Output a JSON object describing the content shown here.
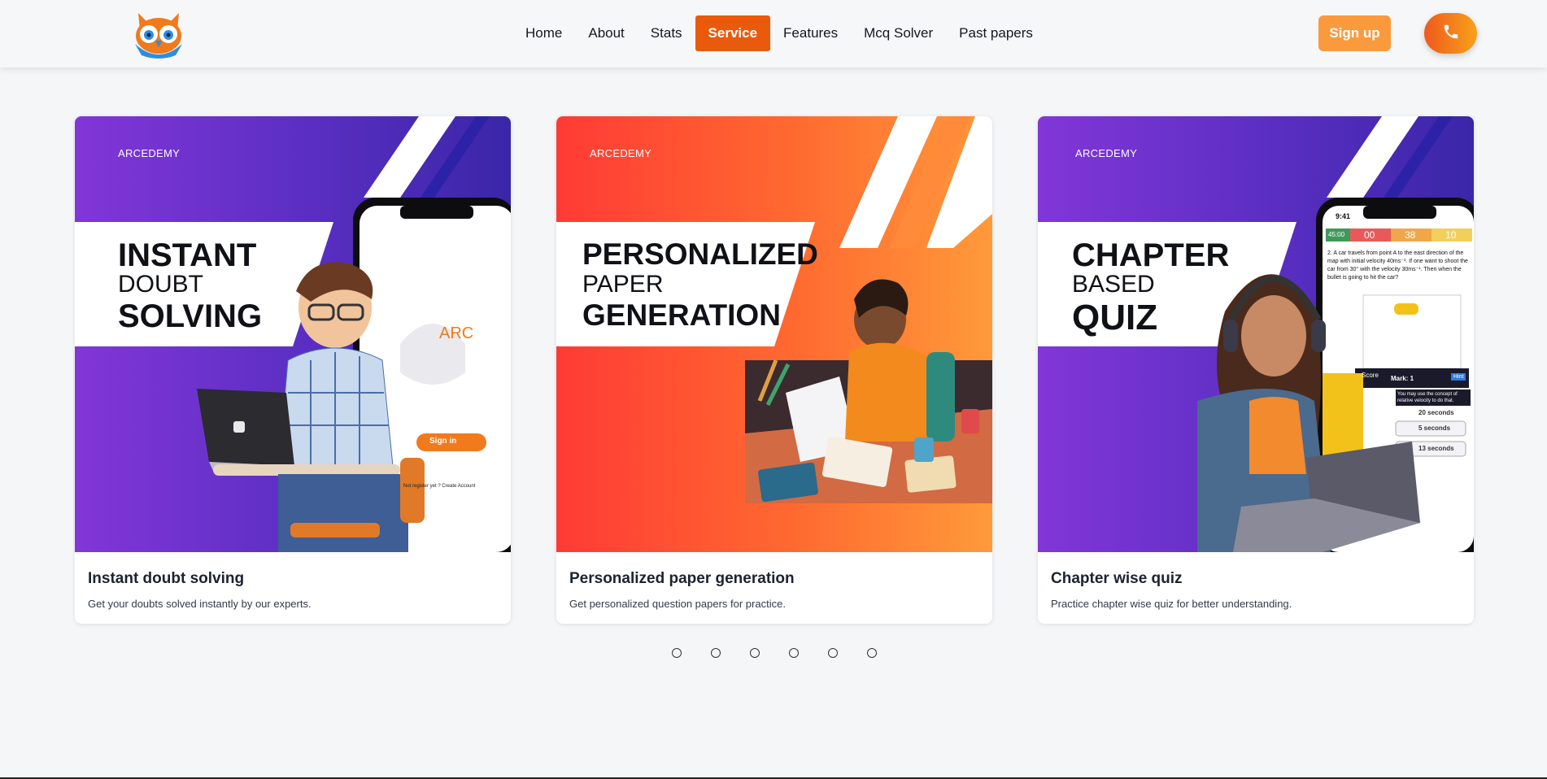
{
  "header": {
    "logo_icon": "owl-logo-icon",
    "nav": [
      {
        "label": "Home",
        "active": false
      },
      {
        "label": "About",
        "active": false
      },
      {
        "label": "Stats",
        "active": false
      },
      {
        "label": "Service",
        "active": true
      },
      {
        "label": "Features",
        "active": false
      },
      {
        "label": "Mcq Solver",
        "active": false
      },
      {
        "label": "Past papers",
        "active": false
      }
    ],
    "signup_label": "Sign up",
    "phone_icon": "phone-icon"
  },
  "cards": [
    {
      "brand": "ARCEDEMY",
      "banner_line1": "INSTANT",
      "banner_line2": "DOUBT",
      "banner_line3": "SOLVING",
      "phone_logo_text": "ARC",
      "phone_signin": "Sign in",
      "phone_footer": "Not register yet ? Create Account",
      "title": "Instant doubt solving",
      "description": "Get your doubts solved instantly by our experts."
    },
    {
      "brand": "ARCEDEMY",
      "banner_line1": "PERSONALIZED",
      "banner_line2": "PAPER",
      "banner_line3": "GENERATION",
      "title": "Personalized paper generation",
      "description": "Get personalized question papers for practice."
    },
    {
      "brand": "ARCEDEMY",
      "banner_line1": "CHAPTER",
      "banner_line2": "BASED",
      "banner_line3": "QUIZ",
      "quiz_time": "9:41",
      "quiz_timer": "45:00",
      "quiz_score1": "00",
      "quiz_score2": "38",
      "quiz_score3": "10",
      "quiz_question": "2. A car travels from point A to the east direction of the map with initial velocity 40ms⁻¹. If one want to shoot the car from 30° with the velocity 30ms⁻¹. Then when the bullet is going to hit the car?",
      "quiz_mark": "Mark: 1",
      "quiz_hint": "Hint",
      "quiz_hint_text": "You may use the concept of relative velocity to do that.",
      "quiz_opt_a": "20 seconds",
      "quiz_opt_b": "5 seconds",
      "quiz_opt_c": "13 seconds",
      "quiz_score_label": "Score",
      "title": "Chapter wise quiz",
      "description": "Practice chapter wise quiz for better understanding."
    }
  ],
  "carousel": {
    "dot_count": 6
  },
  "colors": {
    "accent": "#ea5a0c",
    "signup": "#fb9a3d",
    "purple_start": "#8236d8",
    "purple_end": "#3a26a8",
    "orange_start": "#ff3a35",
    "orange_end": "#ff9a3a"
  }
}
